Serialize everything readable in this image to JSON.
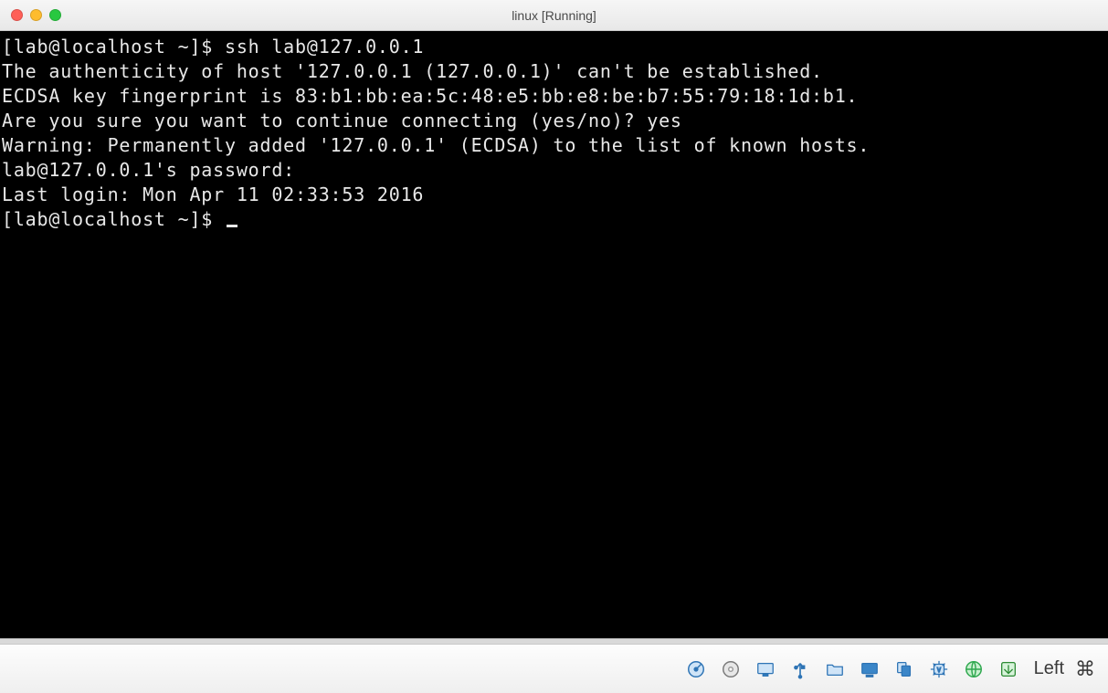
{
  "window": {
    "title": "linux [Running]"
  },
  "terminal": {
    "lines": [
      "[lab@localhost ~]$ ssh lab@127.0.0.1",
      "The authenticity of host '127.0.0.1 (127.0.0.1)' can't be established.",
      "ECDSA key fingerprint is 83:b1:bb:ea:5c:48:e5:bb:e8:be:b7:55:79:18:1d:b1.",
      "Are you sure you want to continue connecting (yes/no)? yes",
      "Warning: Permanently added '127.0.0.1' (ECDSA) to the list of known hosts.",
      "lab@127.0.0.1's password:",
      "Last login: Mon Apr 11 02:33:53 2016",
      "[lab@localhost ~]$ "
    ]
  },
  "statusbar": {
    "host_key_label": "Left",
    "host_key_symbol": "⌘",
    "icons": [
      "harddisk-icon",
      "optical-disc-icon",
      "display-icon",
      "usb-icon",
      "shared-folder-icon",
      "monitor-icon",
      "clipboard-icon",
      "chip-icon",
      "network-icon",
      "capture-icon"
    ]
  }
}
